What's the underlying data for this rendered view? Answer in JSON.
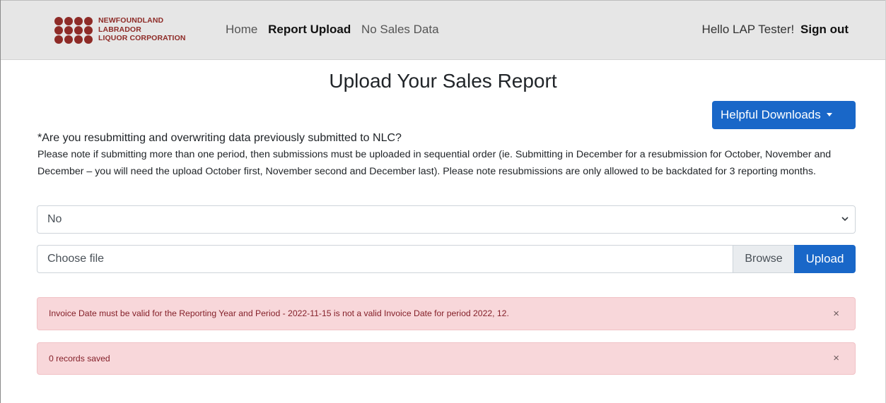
{
  "brand": {
    "logo_lines": [
      "NEWFOUNDLAND",
      "LABRADOR",
      "LIQUOR CORPORATION"
    ],
    "logo_color": "#8e2b27"
  },
  "nav": {
    "links": [
      "Home",
      "Report Upload",
      "No Sales Data"
    ],
    "active": "Report Upload",
    "greeting": "Hello LAP Tester!",
    "signout": "Sign out"
  },
  "page": {
    "title": "Upload Your Sales Report",
    "downloads_button": "Helpful Downloads",
    "question": "*Are you resubmitting and overwriting data previously submitted to NLC?",
    "note": "Please note if submitting more than one period, then submissions must be uploaded in sequential order (ie. Submitting in December for a resubmission for October, November and December – you will need the upload October first, November second and December last). Please note resubmissions are only allowed to be backdated for 3 reporting months.",
    "resubmit_select": {
      "selected": "No"
    },
    "file_input": {
      "placeholder": "Choose file",
      "browse_label": "Browse"
    },
    "upload_button": "Upload"
  },
  "alerts": [
    {
      "message": "Invoice Date must be valid for the Reporting Year and Period - 2022-11-15 is not a valid Invoice Date for period 2022, 12.",
      "close": "×"
    },
    {
      "message": "0 records saved",
      "close": "×"
    }
  ],
  "colors": {
    "primary": "#1967c8",
    "navbar_bg": "#e6e6e6",
    "alert_bg": "#f8d7da",
    "alert_text": "#842029"
  }
}
